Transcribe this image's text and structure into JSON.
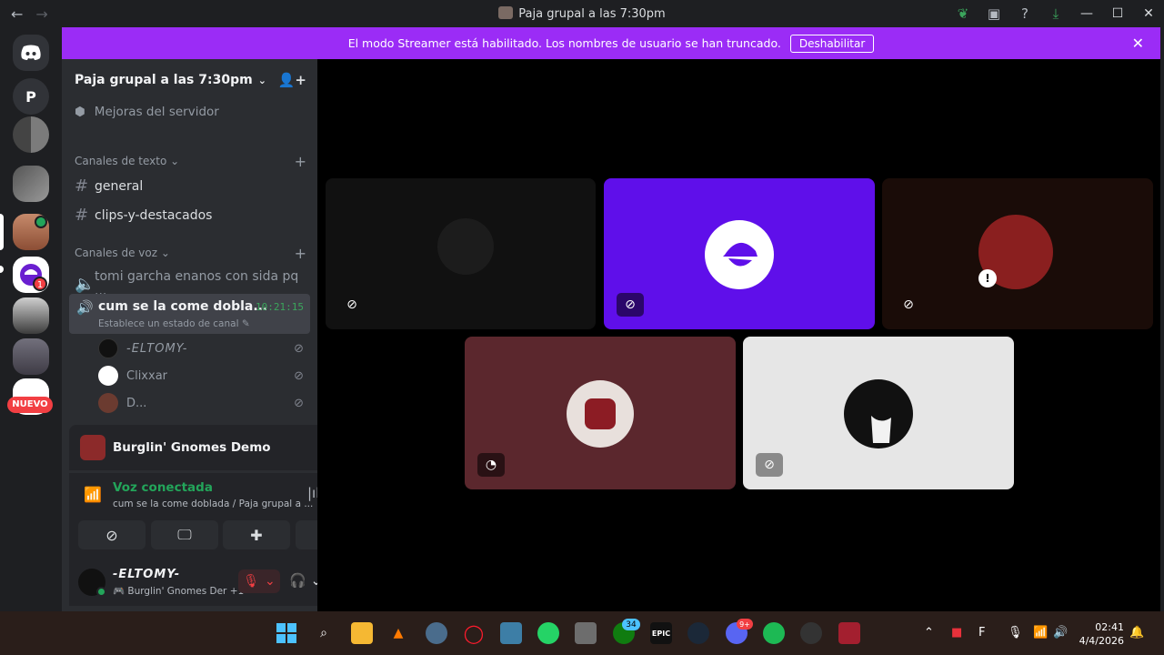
{
  "window": {
    "title": "Paja grupal a las 7:30pm",
    "back_glyph": "←",
    "forward_glyph": "→",
    "minimize_glyph": "—",
    "maximize_glyph": "☐",
    "close_glyph": "✕"
  },
  "banner": {
    "text": "El modo Streamer está habilitado. Los nombres de usuario se han truncado.",
    "button": "Deshabilitar",
    "close": "✕"
  },
  "servers": {
    "p_label": "P",
    "new_badge": "NUEVO",
    "unread_count": "1"
  },
  "sidebar": {
    "server_name": "Paja grupal a las 7:30pm",
    "boost": "Mejoras del servidor",
    "text_category": "Canales de texto",
    "text_channels": [
      "general",
      "clips-y-destacados"
    ],
    "voice_category": "Canales de voz",
    "voice_channels": [
      "tomi garcha enanos con sida pq ...",
      "cum se la come dobla..."
    ],
    "active_timer": "10:21:15",
    "channel_status": "Establece un estado de canal",
    "voice_users": [
      "-ELTOMY-",
      "Clixxar",
      "D..."
    ]
  },
  "activity": {
    "game": "Burglin' Gnomes Demo"
  },
  "voice": {
    "status": "Voz conectada",
    "location": "cum se la come doblada / Paja grupal a ..."
  },
  "user": {
    "name": "-ELTOMY-",
    "activity": "Burglin' Gnomes Der +1"
  },
  "taskbar": {
    "time": "02:41",
    "date": "4/4/2026",
    "xbox_badge": "34",
    "discord_badge": "9+",
    "epic_label": "EPIC"
  },
  "colors": {
    "banner": "#9b2cf6",
    "accent_green": "#23a55a",
    "tile_purple": "#5f0fea",
    "tile_maroon": "#5b272d",
    "tile_light": "#e6e6e6"
  }
}
